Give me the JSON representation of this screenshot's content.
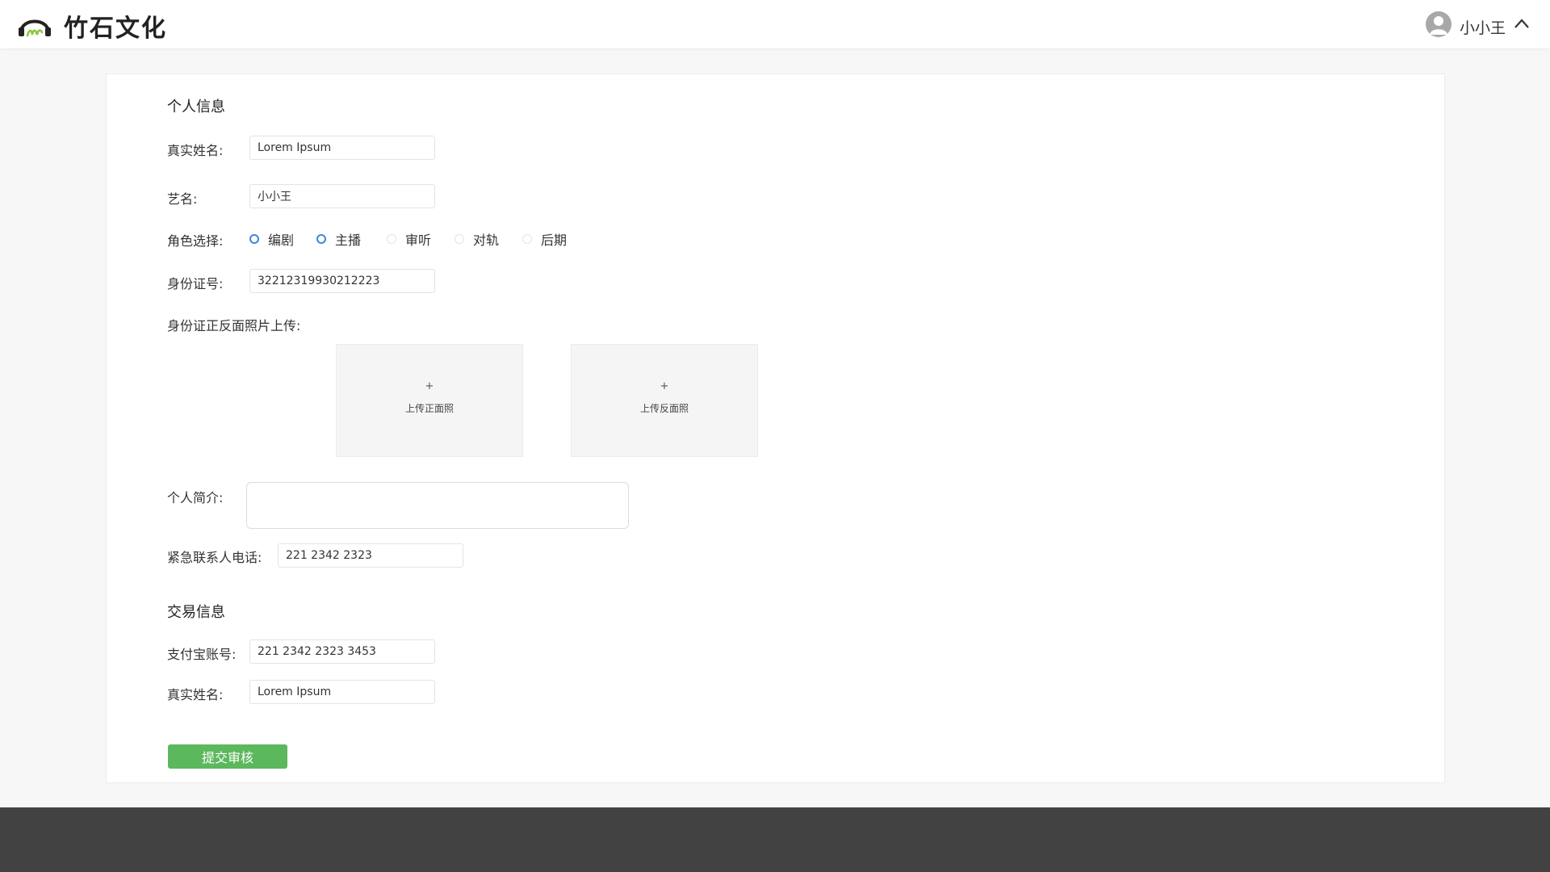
{
  "header": {
    "brand": "竹石文化",
    "username": "小小王",
    "colors": {
      "logo_dark": "#222222",
      "logo_accent": "#8cc63f"
    }
  },
  "personal": {
    "title": "个人信息",
    "real_name": {
      "label": "真实姓名:",
      "value": "Lorem Ipsum"
    },
    "stage_name": {
      "label": "艺名:",
      "value": "小小王"
    },
    "role": {
      "label": "角色选择:",
      "options": [
        {
          "label": "编剧",
          "checked": true
        },
        {
          "label": "主播",
          "checked": true
        },
        {
          "label": "审听",
          "checked": false
        },
        {
          "label": "对轨",
          "checked": false
        },
        {
          "label": "后期",
          "checked": false
        }
      ]
    },
    "id_number": {
      "label": "身份证号:",
      "value": "32212319930212223"
    },
    "id_upload": {
      "label": "身份证正反面照片上传:",
      "front": {
        "plus": "+",
        "text": "上传正面照"
      },
      "back": {
        "plus": "+",
        "text": "上传反面照"
      }
    },
    "bio": {
      "label": "个人简介:",
      "value": ""
    },
    "emergency_phone": {
      "label": "紧急联系人电话:",
      "value": "221 2342 2323"
    }
  },
  "trade": {
    "title": "交易信息",
    "alipay": {
      "label": "支付宝账号:",
      "value": "221 2342 2323 3453"
    },
    "real_name": {
      "label": "真实姓名:",
      "value": "Lorem Ipsum"
    }
  },
  "submit_label": "提交审核",
  "colors": {
    "primary_green": "#5cb85c",
    "radio_blue": "#3d86e0",
    "footer": "#424242"
  }
}
